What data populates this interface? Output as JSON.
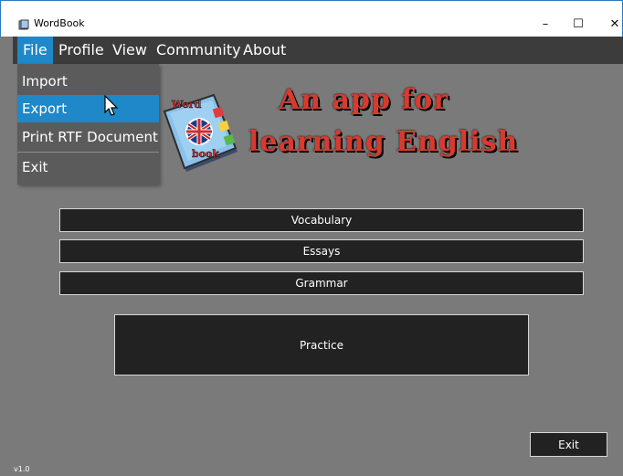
{
  "window": {
    "title": "WordBook",
    "icon": "book-icon"
  },
  "window_controls": {
    "minimize": "–",
    "maximize": "☐",
    "close": "✕"
  },
  "menubar": {
    "items": [
      "File",
      "Profile",
      "View",
      "Community",
      "About"
    ]
  },
  "file_menu": {
    "items": [
      "Import",
      "Export",
      "Print RTF Document",
      "Exit"
    ],
    "highlighted": "Export"
  },
  "logo": {
    "text_top": "Word",
    "text_bottom": "book"
  },
  "headline": {
    "line1": "An app for",
    "line2": "learning English"
  },
  "buttons": {
    "vocabulary": "Vocabulary",
    "essays": "Essays",
    "grammar": "Grammar",
    "practice": "Practice",
    "exit": "Exit"
  },
  "footer": {
    "version": "v1.0"
  }
}
